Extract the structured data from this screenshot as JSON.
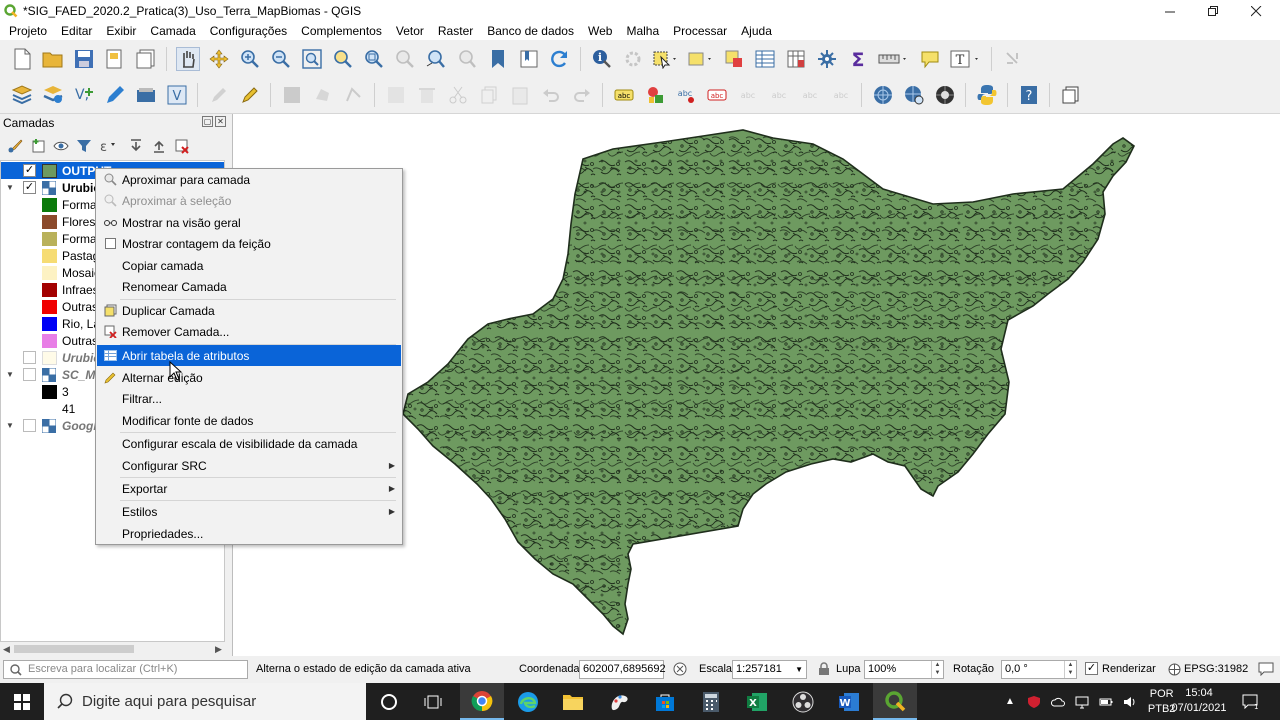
{
  "window": {
    "title": "*SIG_FAED_2020.2_Pratica(3)_Uso_Terra_MapBiomas - QGIS",
    "controls": [
      "minimize",
      "restore",
      "close"
    ]
  },
  "menubar": [
    "Projeto",
    "Editar",
    "Exibir",
    "Camada",
    "Configurações",
    "Complementos",
    "Vetor",
    "Raster",
    "Banco de dados",
    "Web",
    "Malha",
    "Processar",
    "Ajuda"
  ],
  "layers_panel": {
    "title": "Camadas",
    "layers": [
      {
        "name": "OUTPUT",
        "checked": true,
        "selected": true
      },
      {
        "name": "Urubic",
        "checked": true,
        "bold": true
      },
      {
        "name": "Urubic",
        "checked": false,
        "italic": true
      },
      {
        "name": "SC_Ma",
        "checked": false,
        "italic": true
      },
      {
        "name": "Google",
        "checked": false,
        "italic": true
      }
    ],
    "legend_items": [
      {
        "label": "Forma",
        "color": "#0b7a0b"
      },
      {
        "label": "Florest",
        "color": "#8b4a2b"
      },
      {
        "label": "Forma",
        "color": "#b9b15a"
      },
      {
        "label": "Pastag",
        "color": "#f6dc73"
      },
      {
        "label": "Mosaic",
        "color": "#fdf2c3"
      },
      {
        "label": "Infraes",
        "color": "#a30000"
      },
      {
        "label": "Outras",
        "color": "#f00000"
      },
      {
        "label": "Rio, La",
        "color": "#0000f5"
      },
      {
        "label": "Outras",
        "color": "#e87ee6"
      }
    ],
    "sc_legend": [
      {
        "label": "3",
        "color": "#000000"
      },
      {
        "label": "41",
        "color": ""
      }
    ]
  },
  "context_menu": {
    "items": [
      {
        "label": "Aproximar para camada",
        "icon": "zoom-layer-icon",
        "disabled": false
      },
      {
        "label": "Aproximar à seleção",
        "icon": "zoom-selection-icon",
        "disabled": true
      },
      {
        "label": "Mostrar na visão geral",
        "icon": "overview-icon",
        "disabled": false
      },
      {
        "label": "Mostrar contagem da feição",
        "icon": "checkbox-icon",
        "disabled": false
      },
      {
        "label": "Copiar camada",
        "icon": "",
        "disabled": false
      },
      {
        "label": "Renomear Camada",
        "icon": "",
        "disabled": false
      },
      {
        "label": "Duplicar Camada",
        "icon": "duplicate-icon",
        "disabled": false
      },
      {
        "label": "Remover Camada...",
        "icon": "remove-icon",
        "disabled": false
      },
      {
        "label": "Abrir tabela de atributos",
        "icon": "table-icon",
        "disabled": false,
        "highlighted": true
      },
      {
        "label": "Alternar edição",
        "icon": "pencil-icon",
        "disabled": false
      },
      {
        "label": "Filtrar...",
        "icon": "",
        "disabled": false
      },
      {
        "label": "Modificar fonte de dados",
        "icon": "",
        "disabled": false
      },
      {
        "label": "Configurar escala de visibilidade da camada",
        "icon": "",
        "disabled": false
      },
      {
        "label": "Configurar SRC",
        "icon": "",
        "disabled": false,
        "submenu": true
      },
      {
        "label": "Exportar",
        "icon": "",
        "disabled": false,
        "submenu": true
      },
      {
        "label": "Estilos",
        "icon": "",
        "disabled": false,
        "submenu": true
      },
      {
        "label": "Propriedades...",
        "icon": "",
        "disabled": false
      }
    ]
  },
  "statusbar": {
    "search_placeholder": "Escreva para localizar (Ctrl+K)",
    "message": "Alterna o estado de edição da camada ativa",
    "coord_label": "Coordenada",
    "coord_value": "602007,6895692",
    "scale_label": "Escala",
    "scale_value": "1:257181",
    "magnifier_label": "Lupa",
    "magnifier_value": "100%",
    "rotation_label": "Rotação",
    "rotation_value": "0,0 °",
    "render_label": "Renderizar",
    "crs": "EPSG:31982"
  },
  "map": {
    "polygon_fill": "#6e9a60",
    "polygon_stroke": "#1f2e1c"
  },
  "taskbar": {
    "search_placeholder": "Digite aqui para pesquisar",
    "lang": "POR",
    "lang2": "PTB2",
    "time": "15:04",
    "date": "07/01/2021"
  }
}
